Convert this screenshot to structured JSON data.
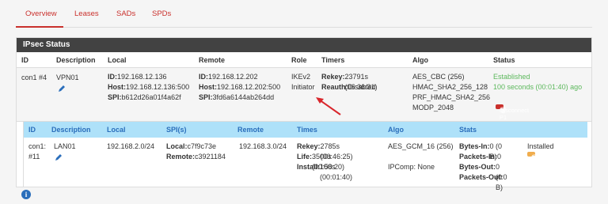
{
  "tabs": [
    "Overview",
    "Leases",
    "SADs",
    "SPDs"
  ],
  "panel": {
    "title": "IPsec Status"
  },
  "p1": {
    "headers": [
      "ID",
      "Description",
      "Local",
      "Remote",
      "Role",
      "Timers",
      "Algo",
      "Status"
    ],
    "id": "con1 #4",
    "description": "VPN01",
    "local": {
      "id_label": "ID:",
      "id": "192.168.12.136",
      "host_label": "Host:",
      "host": "192.168.12.136:500",
      "spi_label": "SPI:",
      "spi": "b612d26a01f4a62f"
    },
    "remote": {
      "id_label": "ID:",
      "id": "192.168.12.202",
      "host_label": "Host:",
      "host": "192.168.12.202:500",
      "spi_label": "SPI:",
      "spi": "3fd6a6144ab264dd"
    },
    "role": [
      "IKEv2",
      "Initiator"
    ],
    "timers": {
      "rekey_label": "Rekey:",
      "rekey": "23791s (06:36:31)",
      "reauth_label": "Reauth:",
      "reauth": "Disabled"
    },
    "algo": [
      "AES_CBC (256)",
      "HMAC_SHA2_256_128",
      "PRF_HMAC_SHA2_256",
      "MODP_2048"
    ],
    "status": [
      "Established",
      "100 seconds (00:01:40) ago"
    ],
    "button": "Disconnect P1"
  },
  "p2": {
    "headers": [
      "ID",
      "Description",
      "Local",
      "SPI(s)",
      "Remote",
      "Times",
      "Algo",
      "Stats"
    ],
    "id": "con1:\n#11",
    "id_line1": "con1:",
    "id_line2": "#11",
    "description": "LAN01",
    "local": "192.168.2.0/24",
    "spi": {
      "local_label": "Local:",
      "local": "c7f9c73e",
      "remote_label": "Remote:",
      "remote": "c3921184"
    },
    "remote": "192.168.3.0/24",
    "times": {
      "rekey_label": "Rekey:",
      "rekey": "2785s (00:46:25)",
      "life_label": "Life:",
      "life": "3500s (00:58:20)",
      "install_label": "Install:",
      "install": "100s (00:01:40)"
    },
    "algo": [
      "AES_GCM_16 (256)",
      "IPComp: None"
    ],
    "stats": {
      "bytes_in_label": "Bytes-In:",
      "bytes_in": "0 (0 B)",
      "packets_in_label": "Packets-In:",
      "packets_in": "0",
      "bytes_out_label": "Bytes-Out:",
      "bytes_out": "0 (0 B)",
      "packets_out_label": "Packets-Out:",
      "packets_out": "0"
    },
    "status": "Installed",
    "button": "Disconnect P2"
  },
  "colors": {
    "accent": "#c9302c",
    "header_dark": "#424242",
    "p2_header": "#aee1f9",
    "established": "#5cb85c",
    "warn": "#f0ad4e"
  }
}
